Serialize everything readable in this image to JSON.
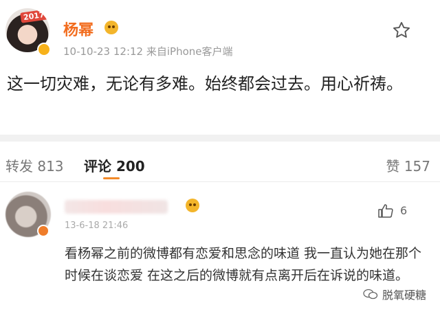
{
  "post": {
    "username": "杨幂",
    "avatar_tag": "2017",
    "meta": "10-10-23 12:12  来自iPhone客户端",
    "content": "这一切灾难，无论有多难。始终都会过去。用心祈祷。"
  },
  "tabs": {
    "repost": "转发 813",
    "comments": "评论 200",
    "likes": "赞 157"
  },
  "comment": {
    "timestamp": "13-6-18 21:46",
    "like_count": "6",
    "text": "看杨幂之前的微博都有恋爱和思念的味道 我一直认为她在那个时候在谈恋爱 在这之后的微博就有点离开后在诉说的味道。"
  },
  "watermark": {
    "text": "脱氧硬糖"
  },
  "colors": {
    "username": "#f26d1f",
    "accent": "#f28a2a",
    "vip_badge": "#f3b52b"
  }
}
